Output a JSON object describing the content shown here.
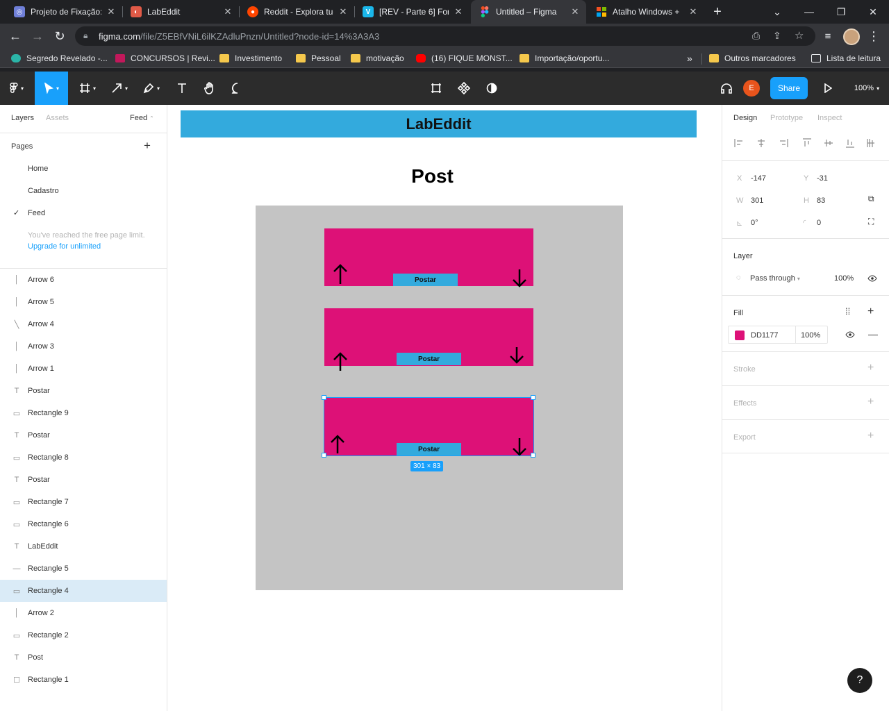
{
  "browser": {
    "tabs": [
      {
        "title": "Projeto de Fixação:",
        "fav": "#6f7fd8",
        "glyph": "◎"
      },
      {
        "title": "LabEddit",
        "fav": "#e05a47",
        "glyph": "◐"
      },
      {
        "title": "Reddit - Explora tuc",
        "fav": "#ff4500",
        "glyph": "●"
      },
      {
        "title": "[REV - Parte 6] Forr",
        "fav": "#1ab7ea",
        "glyph": "V"
      },
      {
        "title": "Untitled – Figma",
        "fav": "#1e1e1e",
        "glyph": "F"
      },
      {
        "title": "Atalho Windows +",
        "fav": "#0078d4",
        "glyph": "▦"
      }
    ],
    "new_tab": "+",
    "url_domain": "figma.com",
    "url_path": "/file/Z5EBfVNiL6ilKZAdluPnzn/Untitled?node-id=14%3A3A3",
    "bookmarks": [
      {
        "label": "Segredo Revelado -...",
        "kind": "site"
      },
      {
        "label": "CONCURSOS | Revi...",
        "kind": "site"
      },
      {
        "label": "Investimento",
        "kind": "folder"
      },
      {
        "label": "Pessoal",
        "kind": "folder"
      },
      {
        "label": "motivação",
        "kind": "folder"
      },
      {
        "label": "(16) FIQUE MONST...",
        "kind": "youtube"
      },
      {
        "label": "Importação/oportu...",
        "kind": "folder"
      }
    ],
    "more_bookmarks": "»",
    "other_bookmarks": "Outros marcadores",
    "reading_list": "Lista de leitura"
  },
  "toolbar": {
    "share_label": "Share",
    "zoom": "100%",
    "avatar_letter": "E"
  },
  "left": {
    "tabs": {
      "layers": "Layers",
      "assets": "Assets",
      "page": "Feed"
    },
    "pages_title": "Pages",
    "pages": [
      "Home",
      "Cadastro",
      "Feed"
    ],
    "current_page": "Feed",
    "limit_msg": "You've reached the free page limit.",
    "upgrade": "Upgrade for unlimited",
    "layers": [
      {
        "name": "Arrow 6",
        "icon": "line-v"
      },
      {
        "name": "Arrow 5",
        "icon": "line-v"
      },
      {
        "name": "Arrow 4",
        "icon": "line-d"
      },
      {
        "name": "Arrow 3",
        "icon": "line-v"
      },
      {
        "name": "Arrow 1",
        "icon": "line-v"
      },
      {
        "name": "Postar",
        "icon": "text"
      },
      {
        "name": "Rectangle 9",
        "icon": "rect-flat"
      },
      {
        "name": "Postar",
        "icon": "text"
      },
      {
        "name": "Rectangle 8",
        "icon": "rect-flat"
      },
      {
        "name": "Postar",
        "icon": "text"
      },
      {
        "name": "Rectangle 7",
        "icon": "rect-flat"
      },
      {
        "name": "Rectangle 6",
        "icon": "rect-flat"
      },
      {
        "name": "LabEddit",
        "icon": "text"
      },
      {
        "name": "Rectangle 5",
        "icon": "line-h"
      },
      {
        "name": "Rectangle 4",
        "icon": "rect-flat"
      },
      {
        "name": "Arrow 2",
        "icon": "line-v"
      },
      {
        "name": "Rectangle 2",
        "icon": "rect-flat"
      },
      {
        "name": "Post",
        "icon": "text"
      },
      {
        "name": "Rectangle 1",
        "icon": "rect"
      }
    ],
    "selected_layer": "Rectangle 4"
  },
  "canvas": {
    "header": "LabEddit",
    "title": "Post",
    "post_button": "Postar",
    "dimension": "301 × 83",
    "colors": {
      "card": "#DD1177",
      "header": "#33AADD",
      "frame": "#C4C4C4"
    }
  },
  "right": {
    "tabs": {
      "design": "Design",
      "prototype": "Prototype",
      "inspect": "Inspect"
    },
    "x_label": "X",
    "x": "-147",
    "y_label": "Y",
    "y": "-31",
    "w_label": "W",
    "w": "301",
    "h_label": "H",
    "h": "83",
    "rotation": "0°",
    "radius": "0",
    "layer_title": "Layer",
    "blend": "Pass through",
    "opacity": "100%",
    "fill_title": "Fill",
    "fill_hex": "DD1177",
    "fill_color": "#DD1177",
    "fill_opacity": "100%",
    "stroke": "Stroke",
    "effects": "Effects",
    "export": "Export"
  },
  "help": "?"
}
